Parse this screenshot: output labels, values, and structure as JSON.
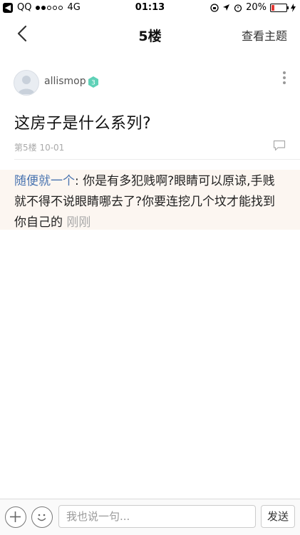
{
  "status_bar": {
    "carrier": "QQ",
    "network": "4G",
    "time": "01:13",
    "battery": "20%",
    "battery_level": 0.2
  },
  "nav": {
    "title": "5楼",
    "right_action": "查看主题"
  },
  "post": {
    "username": "allismop",
    "badge_level": "3",
    "title": "这房子是什么系列?",
    "meta": "第5楼 10-01"
  },
  "reply": {
    "user": "随便就一个",
    "separator": ":",
    "text": "你是有多犯贱啊?眼睛可以原谅,手贱就不得不说眼睛哪去了?你要连挖几个坟才能找到你自己的",
    "time": "刚刚"
  },
  "bottom_bar": {
    "input_placeholder": "我也说一句...",
    "send_label": "发送"
  },
  "colors": {
    "reply_user": "#4a74b0",
    "reply_bg": "#fcf6f1",
    "badge": "#5fd1b7",
    "battery_low": "#e53935"
  }
}
